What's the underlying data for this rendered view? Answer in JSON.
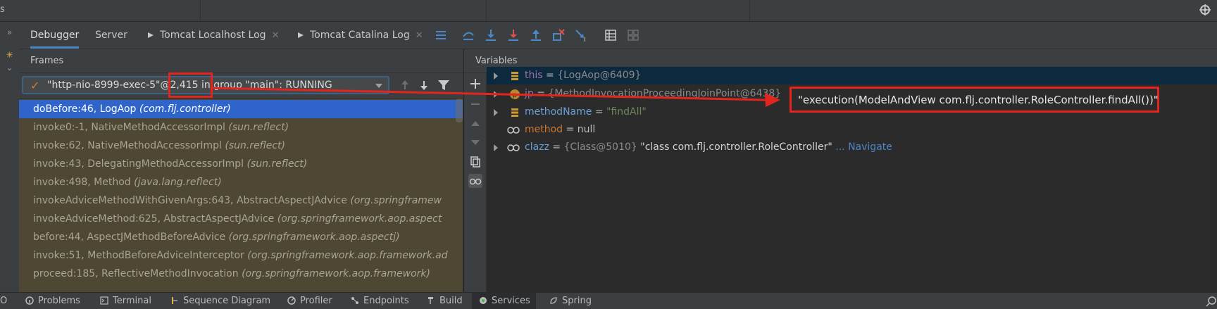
{
  "top": {
    "label": "s"
  },
  "tabs": [
    {
      "label": "Debugger"
    },
    {
      "label": "Server"
    },
    {
      "label": "Tomcat Localhost Log"
    },
    {
      "label": "Tomcat Catalina Log"
    }
  ],
  "frames_header": "Frames",
  "variables_header": "Variables",
  "thread": {
    "label": "\"http-nio-8999-exec-5\"@2,415 in group \"main\": RUNNING"
  },
  "frames": [
    {
      "method": "doBefore:46, LogAop",
      "pkg": "(com.flj.controller)"
    },
    {
      "method": "invoke0:-1, NativeMethodAccessorImpl",
      "pkg": "(sun.reflect)"
    },
    {
      "method": "invoke:62, NativeMethodAccessorImpl",
      "pkg": "(sun.reflect)"
    },
    {
      "method": "invoke:43, DelegatingMethodAccessorImpl",
      "pkg": "(sun.reflect)"
    },
    {
      "method": "invoke:498, Method",
      "pkg": "(java.lang.reflect)"
    },
    {
      "method": "invokeAdviceMethodWithGivenArgs:643, AbstractAspectJAdvice",
      "pkg": "(org.springframew"
    },
    {
      "method": "invokeAdviceMethod:625, AbstractAspectJAdvice",
      "pkg": "(org.springframework.aop.aspect"
    },
    {
      "method": "before:44, AspectJMethodBeforeAdvice",
      "pkg": "(org.springframework.aop.aspectj)"
    },
    {
      "method": "invoke:51, MethodBeforeAdviceInterceptor",
      "pkg": "(org.springframework.aop.framework.ad"
    },
    {
      "method": "proceed:185, ReflectiveMethodInvocation",
      "pkg": "(org.springframework.aop.framework)"
    }
  ],
  "variables": {
    "this": {
      "name": "this",
      "eq": " = ",
      "value": "{LogAop@6409}"
    },
    "jp": {
      "name": "jp",
      "eq": " = ",
      "value": "{MethodInvocationProceedingJoinPoint@6438}"
    },
    "methodName": {
      "name": "methodName",
      "eq": " = ",
      "value": "\"findAll\""
    },
    "method": {
      "name": "method",
      "eq": " = ",
      "value": "null"
    },
    "clazz": {
      "name": "clazz",
      "eq": " = ",
      "type": "{Class@5010} ",
      "value": "\"class com.flj.controller.RoleController\"",
      "link": " ... Navigate"
    }
  },
  "callout": "\"execution(ModelAndView com.flj.controller.RoleController.findAll())\"",
  "status": [
    {
      "label": "O"
    },
    {
      "label": "Problems"
    },
    {
      "label": "Terminal"
    },
    {
      "label": "Sequence Diagram"
    },
    {
      "label": "Profiler"
    },
    {
      "label": "Endpoints"
    },
    {
      "label": "Build"
    },
    {
      "label": "Services"
    },
    {
      "label": "Spring"
    }
  ],
  "colors": {
    "accent": "#4a88c7",
    "selected_frame": "#2f65ca",
    "annotation_red": "#e3251f",
    "thread_check": "#e0762a"
  },
  "icons": [
    "gear-icon",
    "close-icon",
    "menu-icon",
    "step-over-icon",
    "step-into-icon",
    "force-step-into-icon",
    "step-out-icon",
    "drop-frame-icon",
    "run-to-cursor-icon",
    "evaluate-icon",
    "restore-layout-icon",
    "filter-icon",
    "add-icon",
    "remove-icon",
    "copy-icon",
    "watch-icon"
  ]
}
